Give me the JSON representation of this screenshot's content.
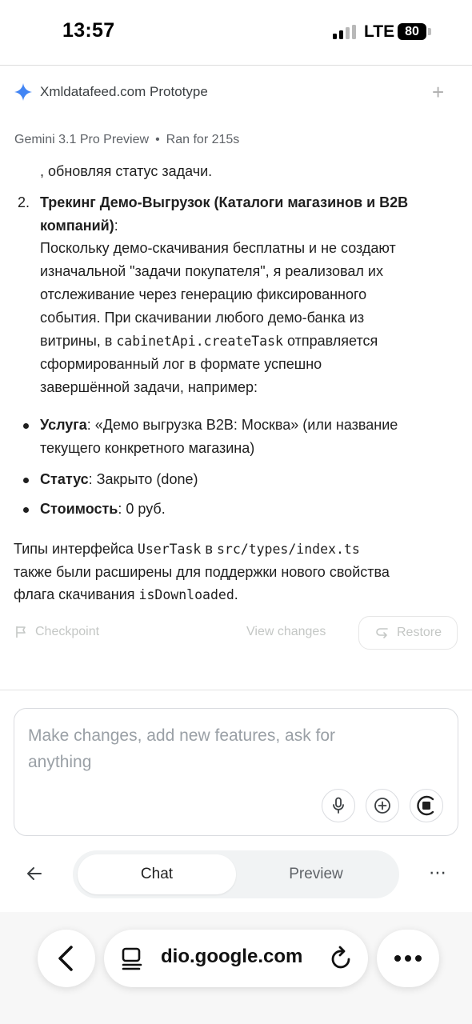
{
  "status_bar": {
    "time": "13:57",
    "network": "LTE",
    "battery": "80"
  },
  "header": {
    "project_title": "Xmldatafeed.com Prototype",
    "model": "Gemini 3.1 Pro Preview",
    "separator": "•",
    "run_info": "Ran for 215s"
  },
  "message": {
    "continuation": ", обновляя статус задачи.",
    "item2_number": "2.",
    "item2_title_line1": "Трекинг Демо-Выгрузок (Каталоги магазинов и B2B",
    "item2_title_line2": "компаний)",
    "item2_title_colon": ":",
    "item2_body_1": "Поскольку демо-скачивания бесплатны и не создают",
    "item2_body_2": "изначальной \"задачи покупателя\", я реализовал их",
    "item2_body_3": "отслеживание через генерацию фиксированного",
    "item2_body_4": "события. При скачивании любого демо-банка из",
    "item2_body_5_pre": "витрины, в ",
    "item2_body_5_code": "cabinetApi.createTask",
    "item2_body_5_post": " отправляется",
    "item2_body_6": "сформированный лог в формате успешно",
    "item2_body_7": "завершённой задачи, например:",
    "bullets": [
      {
        "label": "Услуга",
        "text_line1": ": «Демо выгрузка B2B: Москва» (или название",
        "text_line2": "текущего конкретного магазина)"
      },
      {
        "label": "Статус",
        "text_line1": ": Закрыто (done)"
      },
      {
        "label": "Стоимость",
        "text_line1": ": 0 руб."
      }
    ],
    "footer_1_pre": "Типы интерфейса ",
    "footer_1_code1": "UserTask",
    "footer_1_mid": " в ",
    "footer_1_code2": "src/types/index.ts",
    "footer_2": "также были расширены для поддержки нового свойства",
    "footer_3_pre": "флага скачивания ",
    "footer_3_code": "isDownloaded",
    "footer_3_post": "."
  },
  "actions": {
    "checkpoint": "Checkpoint",
    "view_changes": "View changes",
    "restore": "Restore"
  },
  "composer": {
    "placeholder_line1": "Make changes, add new features, ask for",
    "placeholder_line2": "anything"
  },
  "tabs": {
    "chat": "Chat",
    "preview": "Preview"
  },
  "browser": {
    "url": "dio.google.com"
  },
  "icons": {
    "spark": "gemini-spark-icon",
    "plus": "plus-icon",
    "flag": "flag-icon",
    "restore": "restore-icon",
    "mic": "mic-icon",
    "add": "add-circle-icon",
    "stop": "stop-icon",
    "back": "back-arrow-icon",
    "more": "more-horizontal-icon",
    "safari_back": "chevron-left-icon",
    "reader": "reader-icon",
    "reload": "reload-icon",
    "safari_more": "ellipsis-icon"
  },
  "colors": {
    "accent_blue": "#4285f4",
    "text": "#1f1f1f",
    "muted": "#5f6368"
  }
}
